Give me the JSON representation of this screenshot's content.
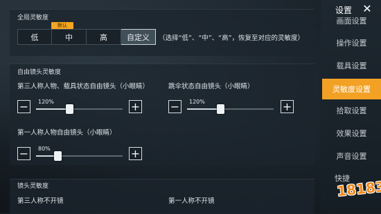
{
  "global": {
    "title": "全局灵敏度",
    "badge": "默认",
    "options": [
      "低",
      "中",
      "高",
      "自定义"
    ],
    "selected": "自定义",
    "hint": "（选择“低”、“中”、“高”，恢复至对应的灵敏度）"
  },
  "free_look": {
    "title": "自由镜头灵敏度",
    "sliders": [
      {
        "label": "第三人称人物、载具状态自由镜头（小眼睛）",
        "value_text": "120%",
        "fraction": 0.38
      },
      {
        "label": "跳伞状态自由镜头（小眼睛）",
        "value_text": "120%",
        "fraction": 0.38
      },
      {
        "label": "第一人称人物自由镜头（小眼睛）",
        "value_text": "80%",
        "fraction": 0.25
      }
    ],
    "minus": "−",
    "plus": "+"
  },
  "lens": {
    "title": "镜头灵敏度",
    "col1": "第三人称不开镜",
    "col2": "第一人称不开镜"
  },
  "sidebar": {
    "title": "设置",
    "close": "✕",
    "items": [
      "画面设置",
      "操作设置",
      "载具设置",
      "灵敏度设置",
      "拾取设置",
      "效果设置",
      "声音设置",
      "快捷"
    ],
    "active": "灵敏度设置"
  },
  "watermark": "18183",
  "colors": {
    "accent": "#f2a125",
    "badge": "#f5a623"
  },
  "icons": [
    "close-icon",
    "minus-icon",
    "plus-icon"
  ]
}
